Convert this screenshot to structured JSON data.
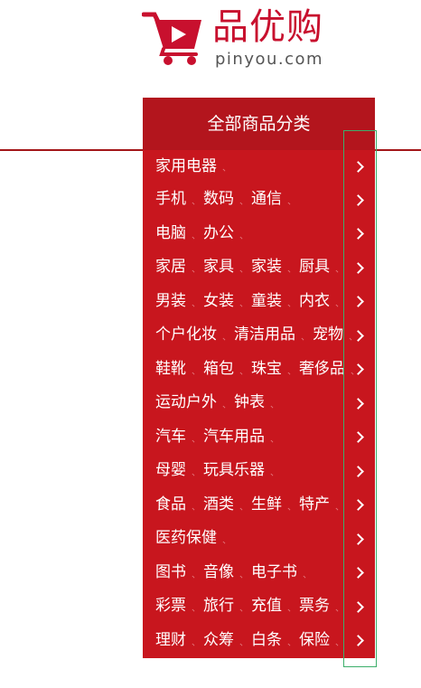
{
  "logo": {
    "title": "品优购",
    "domain": "pinyou.com"
  },
  "colors": {
    "brand_red": "#c8161e",
    "header_red": "#b3151d",
    "divider_red": "#a31619",
    "focus_outline": "#3cae6a"
  },
  "category_menu": {
    "header": "全部商品分类",
    "items": [
      {
        "links": [
          "家用电器"
        ]
      },
      {
        "links": [
          "手机",
          "数码",
          "通信"
        ]
      },
      {
        "links": [
          "电脑",
          "办公"
        ]
      },
      {
        "links": [
          "家居",
          "家具",
          "家装",
          "厨具"
        ]
      },
      {
        "links": [
          "男装",
          "女装",
          "童装",
          "内衣"
        ]
      },
      {
        "links": [
          "个户化妆",
          "清洁用品",
          "宠物"
        ]
      },
      {
        "links": [
          "鞋靴",
          "箱包",
          "珠宝",
          "奢侈品"
        ]
      },
      {
        "links": [
          "运动户外",
          "钟表"
        ]
      },
      {
        "links": [
          "汽车",
          "汽车用品"
        ]
      },
      {
        "links": [
          "母婴",
          "玩具乐器"
        ]
      },
      {
        "links": [
          "食品",
          "酒类",
          "生鲜",
          "特产"
        ]
      },
      {
        "links": [
          "医药保健"
        ]
      },
      {
        "links": [
          "图书",
          "音像",
          "电子书"
        ]
      },
      {
        "links": [
          "彩票",
          "旅行",
          "充值",
          "票务"
        ]
      },
      {
        "links": [
          "理财",
          "众筹",
          "白条",
          "保险"
        ]
      }
    ]
  }
}
